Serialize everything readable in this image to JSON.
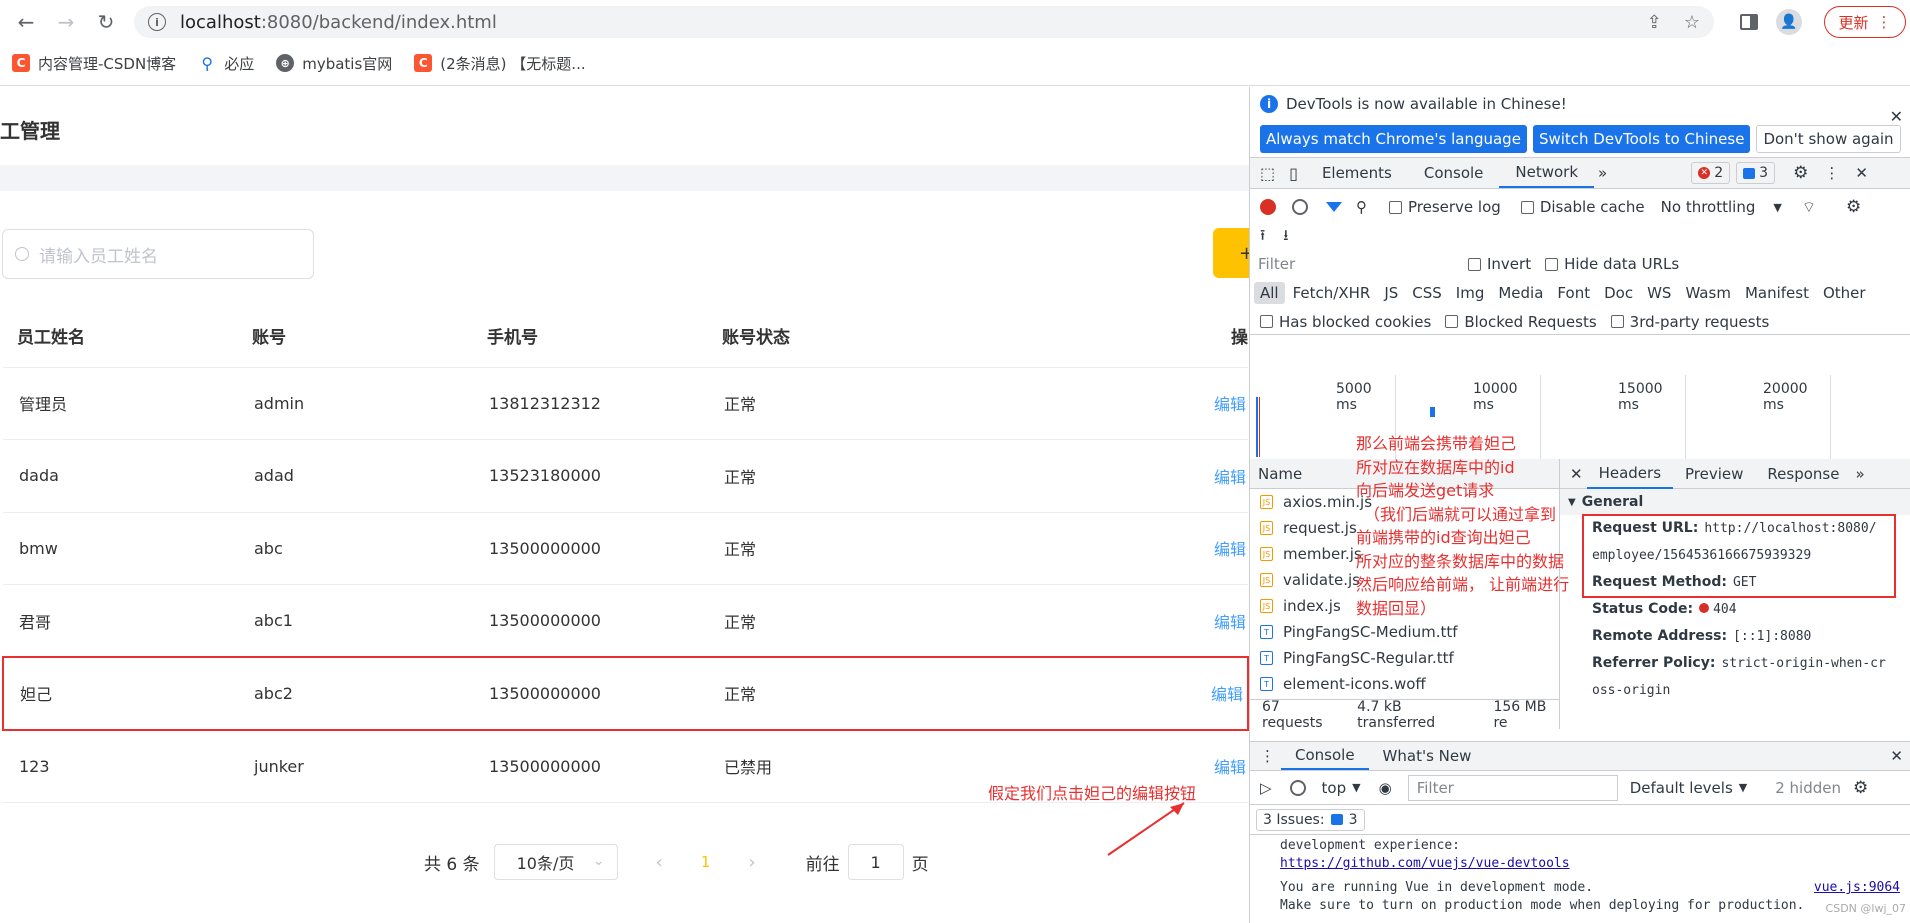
{
  "browser": {
    "url_host": "localhost",
    "url_rest": ":8080/backend/index.html",
    "update_label": "更新",
    "bookmarks": [
      {
        "label": "内容管理-CSDN博客",
        "icon": "csdn-icon"
      },
      {
        "label": "必应",
        "icon": "bing-icon"
      },
      {
        "label": "mybatis官网",
        "icon": "globe-icon"
      },
      {
        "label": "(2条消息) 【无标题...",
        "icon": "csdn-icon"
      }
    ]
  },
  "page": {
    "title": "工管理",
    "search_placeholder": "请输入员工姓名",
    "add_label": "+",
    "table": {
      "headers": [
        "员工姓名",
        "账号",
        "手机号",
        "账号状态",
        "操"
      ],
      "rows": [
        {
          "name": "管理员",
          "account": "admin",
          "phone": "13812312312",
          "status": "正常",
          "action": "编辑"
        },
        {
          "name": "dada",
          "account": "adad",
          "phone": "13523180000",
          "status": "正常",
          "action": "编辑"
        },
        {
          "name": "bmw",
          "account": "abc",
          "phone": "13500000000",
          "status": "正常",
          "action": "编辑"
        },
        {
          "name": "君哥",
          "account": "abc1",
          "phone": "13500000000",
          "status": "正常",
          "action": "编辑"
        },
        {
          "name": "妲己",
          "account": "abc2",
          "phone": "13500000000",
          "status": "正常",
          "action": "编辑"
        },
        {
          "name": "123",
          "account": "junker",
          "phone": "13500000000",
          "status": "已禁用",
          "action": "编辑"
        }
      ]
    },
    "pager": {
      "total": "共 6 条",
      "page_size": "10条/页",
      "current": "1",
      "goto_label": "前往",
      "goto_value": "1",
      "page_suffix": "页"
    },
    "annotation": "假定我们点击妲己的编辑按钮"
  },
  "devtools": {
    "banner_text": "DevTools is now available in Chinese!",
    "banner_buttons": [
      "Always match Chrome's language",
      "Switch DevTools to Chinese",
      "Don't show again"
    ],
    "tabs": [
      "Elements",
      "Console",
      "Network"
    ],
    "error_count": "2",
    "message_count": "3",
    "preserve_log": "Preserve log",
    "disable_cache": "Disable cache",
    "throttling": "No throttling",
    "filter_placeholder": "Filter",
    "invert": "Invert",
    "hide_data_urls": "Hide data URLs",
    "types": [
      "All",
      "Fetch/XHR",
      "JS",
      "CSS",
      "Img",
      "Media",
      "Font",
      "Doc",
      "WS",
      "Wasm",
      "Manifest",
      "Other"
    ],
    "blocked_cookies": "Has blocked cookies",
    "blocked_requests": "Blocked Requests",
    "third_party": "3rd-party requests",
    "timeline_labels": [
      "5000 ms",
      "10000 ms",
      "15000 ms",
      "20000 ms"
    ],
    "name_header": "Name",
    "files": [
      {
        "name": "axios.min.js",
        "type": "js"
      },
      {
        "name": "request.js",
        "type": "js"
      },
      {
        "name": "member.js",
        "type": "js"
      },
      {
        "name": "validate.js",
        "type": "js"
      },
      {
        "name": "index.js",
        "type": "js"
      },
      {
        "name": "PingFangSC-Medium.ttf",
        "type": "font"
      },
      {
        "name": "PingFangSC-Regular.ttf",
        "type": "font"
      },
      {
        "name": "element-icons.woff",
        "type": "font"
      }
    ],
    "requests_count": "67 requests",
    "transferred": "4.7 kB transferred",
    "resources": "156 MB re",
    "detail_tabs": [
      "Headers",
      "Preview",
      "Response"
    ],
    "general_label": "General",
    "request_url_key": "Request URL:",
    "request_url_value_1": "http://localhost:8080/",
    "request_url_value_2": "employee/1564536166675939329",
    "request_method_key": "Request Method:",
    "request_method_value": "GET",
    "status_code_key": "Status Code:",
    "status_code_value": "404",
    "remote_address_key": "Remote Address:",
    "remote_address_value": "[::1]:8080",
    "referrer_policy_key": "Referrer Policy:",
    "referrer_policy_value_1": "strict-origin-when-cr",
    "referrer_policy_value_2": "oss-origin",
    "console_tabs": [
      "Console",
      "What's New"
    ],
    "console_context": "top",
    "console_filter": "Filter",
    "default_levels": "Default levels",
    "hidden_count": "2 hidden",
    "issues_label": "3 Issues:",
    "issues_count": "3",
    "log_lines": [
      "development experience:",
      "https://github.com/vuejs/vue-devtools",
      "You are running Vue in development mode.",
      "Make sure to turn on production mode when deploying for production."
    ],
    "log_source": "vue.js:9064",
    "watermark": "CSDN @lwj_07",
    "annotation_lines": [
      "那么前端会携带着妲己",
      "所对应在数据库中的id",
      "向后端发送get请求",
      "（我们后端就可以通过拿到",
      "前端携带的id查询出妲己",
      "所对应的整条数据库中的数据",
      "然后响应给前端， 让前端进行",
      "数据回显）"
    ]
  }
}
